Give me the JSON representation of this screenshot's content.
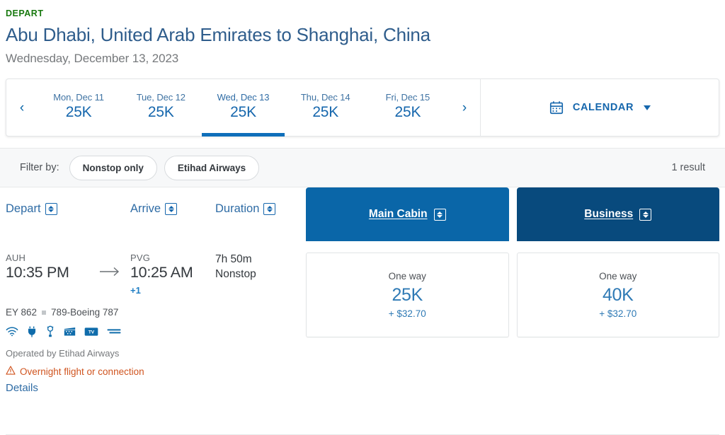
{
  "header": {
    "depart_label": "DEPART",
    "route_title": "Abu Dhabi, United Arab Emirates to Shanghai, China",
    "route_date": "Wednesday, December 13, 2023"
  },
  "date_strip": {
    "prev_arrow": "‹",
    "next_arrow": "›",
    "dates": [
      {
        "day": "Mon, Dec 11",
        "price": "25K",
        "selected": false
      },
      {
        "day": "Tue, Dec 12",
        "price": "25K",
        "selected": false
      },
      {
        "day": "Wed, Dec 13",
        "price": "25K",
        "selected": true
      },
      {
        "day": "Thu, Dec 14",
        "price": "25K",
        "selected": false
      },
      {
        "day": "Fri, Dec 15",
        "price": "25K",
        "selected": false
      }
    ],
    "calendar_label": "CALENDAR",
    "calendar_icon": "calendar-icon",
    "caret_icon": "chevron-down-icon"
  },
  "filters": {
    "label": "Filter by:",
    "pills": [
      "Nonstop only",
      "Etihad Airways"
    ],
    "result_count": "1 result"
  },
  "columns": {
    "depart": "Depart",
    "arrive": "Arrive",
    "duration": "Duration",
    "sort_icon": "sort-icon"
  },
  "cabins": [
    {
      "label": "Main Cabin",
      "color": "#0a66a8"
    },
    {
      "label": "Business",
      "color": "#084a7d"
    }
  ],
  "flight": {
    "depart_code": "AUH",
    "depart_time": "10:35 PM",
    "arrive_code": "PVG",
    "arrive_time": "10:25 AM",
    "day_offset": "+1",
    "duration": "7h 50m",
    "stops": "Nonstop",
    "flight_number": "EY 862",
    "aircraft": "789-Boeing 787",
    "amenities": [
      "wifi-icon",
      "power-outlet-icon",
      "usb-port-icon",
      "movies-icon",
      "tv-icon",
      "lie-flat-seat-icon"
    ],
    "operated_by": "Operated by Etihad Airways",
    "warning_icon": "warning-triangle-icon",
    "warning_text": "Overnight flight or connection",
    "details_link": "Details",
    "arrow_icon": "arrow-right-icon"
  },
  "fares": [
    {
      "type": "One way",
      "miles": "25K",
      "tax": "+ $32.70"
    },
    {
      "type": "One way",
      "miles": "40K",
      "tax": "+ $32.70"
    }
  ],
  "colors": {
    "depart_green": "#18790f",
    "title_blue": "#2f5d8c",
    "link_blue": "#1667ad",
    "main_cabin_blue": "#0a66a8",
    "business_navy": "#084a7d",
    "warning_orange": "#d0541f"
  }
}
